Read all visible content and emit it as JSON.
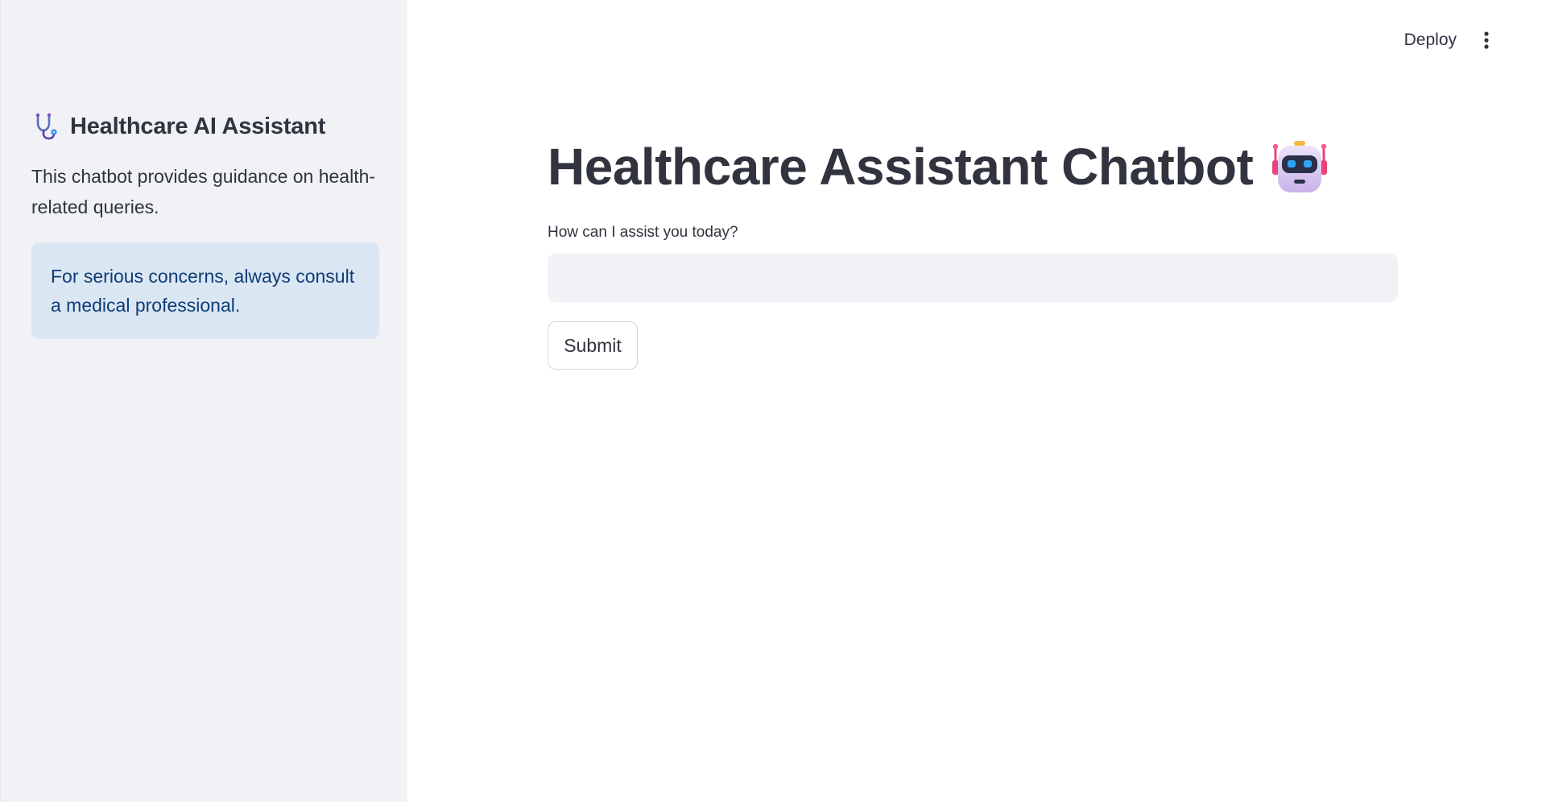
{
  "sidebar": {
    "title": "Healthcare AI Assistant",
    "title_icon": "stethoscope-icon",
    "description": "This chatbot provides guidance on health-related queries.",
    "info": "For serious concerns, always consult a medical professional."
  },
  "topbar": {
    "deploy_label": "Deploy",
    "menu_icon": "kebab-menu-icon"
  },
  "main": {
    "title": "Healthcare Assistant Chatbot",
    "title_icon": "robot-icon",
    "input_label": "How can I assist you today?",
    "input_value": "",
    "input_placeholder": "",
    "submit_label": "Submit"
  },
  "colors": {
    "sidebar_bg": "#f0f2f6",
    "info_bg": "#dbe6f3",
    "info_text": "#0c3d75",
    "text": "#31333f"
  }
}
